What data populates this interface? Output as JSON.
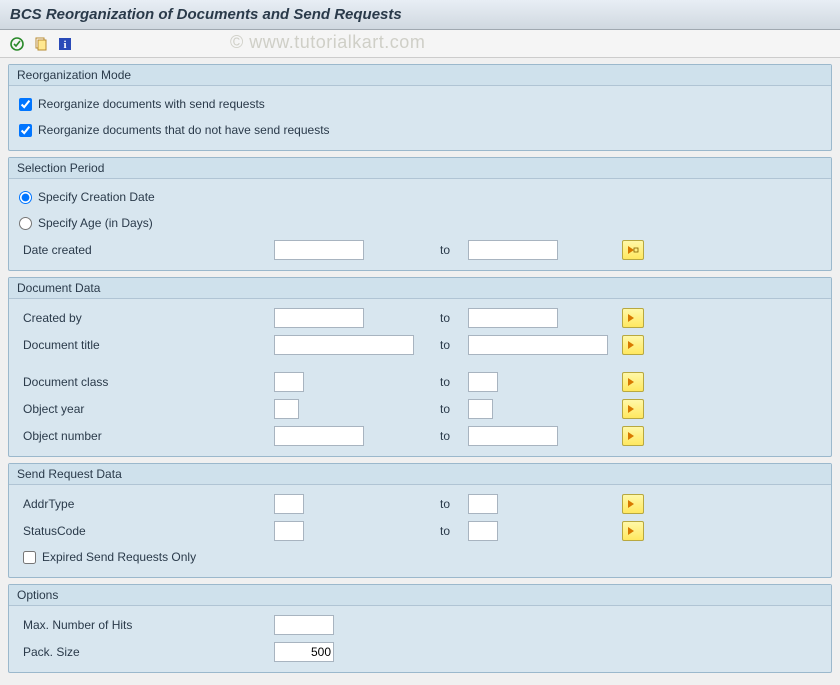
{
  "title": "BCS Reorganization of Documents and Send Requests",
  "watermark": "© www.tutorialkart.com",
  "groups": {
    "reorgMode": {
      "title": "Reorganization Mode",
      "opt1": "Reorganize documents with send requests",
      "opt2": "Reorganize documents that do not have send requests"
    },
    "selectionPeriod": {
      "title": "Selection Period",
      "radio1": "Specify Creation Date",
      "radio2": "Specify Age (in Days)",
      "dateCreatedLabel": "Date created",
      "to": "to",
      "dateFrom": "",
      "dateTo": ""
    },
    "documentData": {
      "title": "Document Data",
      "createdByLabel": "Created by",
      "createdByFrom": "",
      "createdByTo": "",
      "docTitleLabel": "Document title",
      "docTitleFrom": "",
      "docTitleTo": "",
      "docClassLabel": "Document class",
      "docClassFrom": "",
      "docClassTo": "",
      "objYearLabel": "Object year",
      "objYearFrom": "",
      "objYearTo": "",
      "objNumLabel": "Object number",
      "objNumFrom": "",
      "objNumTo": "",
      "to": "to"
    },
    "sendRequest": {
      "title": "Send Request Data",
      "addrTypeLabel": "AddrType",
      "addrTypeFrom": "",
      "addrTypeTo": "",
      "statusCodeLabel": "StatusCode",
      "statusCodeFrom": "",
      "statusCodeTo": "",
      "expiredLabel": "Expired Send Requests Only",
      "to": "to"
    },
    "options": {
      "title": "Options",
      "maxHitsLabel": "Max. Number of Hits",
      "maxHitsVal": "",
      "packSizeLabel": "Pack. Size",
      "packSizeVal": "500"
    }
  }
}
